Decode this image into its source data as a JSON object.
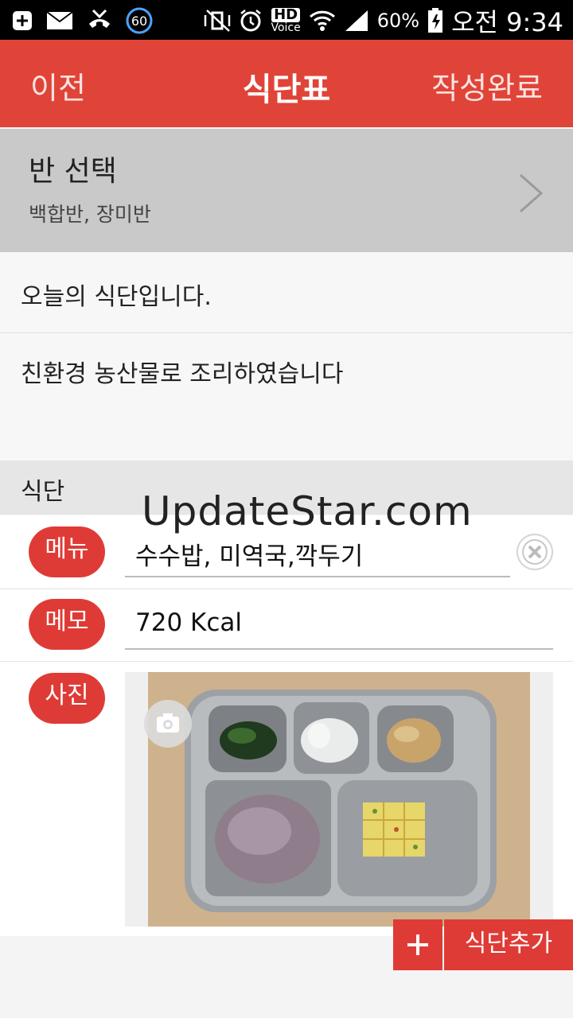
{
  "status_bar": {
    "notification_badge": "60",
    "battery": "60%",
    "hd_top": "HD",
    "hd_bottom": "Voice",
    "time": "오전 9:34"
  },
  "app_bar": {
    "back_label": "이전",
    "title": "식단표",
    "done_label": "작성완료"
  },
  "class_select": {
    "label": "반 선택",
    "value": "백합반, 장미반"
  },
  "notice": {
    "title": "오늘의 식단입니다.",
    "body": "친환경 농산물로 조리하였습니다"
  },
  "section": {
    "header": "식단"
  },
  "watermark": "UpdateStar.com",
  "fields": {
    "menu": {
      "label": "메뉴",
      "value": "수수밥, 미역국,깍두기"
    },
    "memo": {
      "label": "메모",
      "value": "720 Kcal"
    },
    "photo": {
      "label": "사진"
    }
  },
  "bottom": {
    "add_label": "식단추가"
  },
  "colors": {
    "accent": "#e04438",
    "pill": "#df3b36",
    "header_gray": "#c9c9c9"
  }
}
